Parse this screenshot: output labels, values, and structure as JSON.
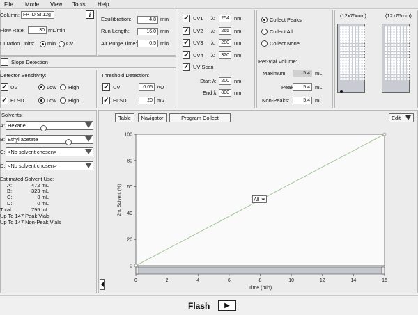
{
  "menu": [
    "File",
    "Mode",
    "View",
    "Tools",
    "Help"
  ],
  "column": {
    "label": "Column:",
    "value": "FP ID SI 12g",
    "info_icon": "i"
  },
  "flow_rate": {
    "label": "Flow Rate:",
    "value": "30",
    "unit": "mL/min"
  },
  "duration_units": {
    "label": "Duration Units:",
    "options": [
      "min",
      "CV"
    ],
    "selected": "min"
  },
  "equilibration": {
    "label": "Equilibration:",
    "value": "4.8",
    "unit": "min"
  },
  "run_length": {
    "label": "Run Length:",
    "value": "16.0",
    "unit": "min"
  },
  "air_purge": {
    "label": "Air Purge Time:",
    "value": "0.5",
    "unit": "min"
  },
  "slope_detection": {
    "label": "Slope Detection",
    "checked": false
  },
  "detector": {
    "title": "Detector Sensitivity:",
    "rows": [
      {
        "name": "UV",
        "checked": true,
        "options": [
          "Low",
          "High"
        ],
        "selected": "Low"
      },
      {
        "name": "ELSD",
        "checked": true,
        "options": [
          "Low",
          "High"
        ],
        "selected": "Low"
      }
    ]
  },
  "threshold": {
    "title": "Threshold Detection:",
    "rows": [
      {
        "name": "UV",
        "checked": true,
        "value": "0.05",
        "unit": "AU"
      },
      {
        "name": "ELSD",
        "checked": true,
        "value": "20",
        "unit": "mV"
      }
    ]
  },
  "uv_channels": [
    {
      "name": "UV1",
      "lambda": "λ:",
      "value": "254",
      "unit": "nm"
    },
    {
      "name": "UV2",
      "lambda": "λ:",
      "value": "265",
      "unit": "nm"
    },
    {
      "name": "UV3",
      "lambda": "λ:",
      "value": "280",
      "unit": "nm"
    },
    {
      "name": "UV4",
      "lambda": "λ:",
      "value": "320",
      "unit": "nm"
    }
  ],
  "uv_scan": {
    "label": "UV Scan",
    "start_label": "Start λ:",
    "start": "200",
    "end_label": "End λ:",
    "end": "800",
    "unit": "nm"
  },
  "collect": {
    "options": [
      "Collect Peaks",
      "Collect All",
      "Collect None"
    ],
    "selected": "Collect Peaks"
  },
  "per_vial": {
    "title": "Per-Vial Volume:",
    "rows": [
      {
        "label": "Maximum:",
        "value": "5.4",
        "unit": "mL"
      },
      {
        "label": "Peak:",
        "value": "5.4",
        "unit": "mL"
      },
      {
        "label": "Non-Peaks:",
        "value": "5.4",
        "unit": "mL"
      }
    ]
  },
  "racks": [
    {
      "label": "(12x75mm)"
    },
    {
      "label": "(12x75mm)"
    }
  ],
  "solvents": {
    "title": "Solvents:",
    "rows": [
      {
        "letter": "A:",
        "value": "Hexane"
      },
      {
        "letter": "B:",
        "value": "Ethyl acetate"
      },
      {
        "letter": "C:",
        "value": "<No solvent chosen>"
      },
      {
        "letter": "D:",
        "value": "<No solvent chosen>"
      }
    ]
  },
  "usage": {
    "title": "Estimated Solvent Use:",
    "rows": [
      {
        "letter": "A:",
        "value": "472 mL"
      },
      {
        "letter": "B:",
        "value": "323 mL"
      },
      {
        "letter": "C:",
        "value": "0 mL"
      },
      {
        "letter": "D:",
        "value": "0 mL"
      },
      {
        "letter": "Total:",
        "value": "795 mL"
      }
    ],
    "peak_vials": "Up To 147 Peak Vials",
    "nonpeak_vials": "Up To 147 Non-Peak Vials"
  },
  "chart_tabs": [
    "Table",
    "Navigator",
    "Program Collect"
  ],
  "edit_button": "Edit",
  "chart_data": {
    "type": "line",
    "series": [
      {
        "x": [
          0,
          16
        ],
        "y": [
          0,
          100
        ]
      }
    ],
    "xlabel": "Time (min)",
    "ylabel": "2nd Solvent (%)",
    "xlim": [
      0,
      16
    ],
    "ylim": [
      0,
      100
    ],
    "xticks": [
      "0",
      "2",
      "4",
      "6",
      "8",
      "10",
      "12",
      "14",
      "16"
    ],
    "yticks": [
      "0",
      "20",
      "40",
      "60",
      "80",
      "100"
    ],
    "selector": "All",
    "grid": false
  },
  "footer": {
    "title": "Flash",
    "play_icon": "▶"
  },
  "colors": {
    "line": "#a6c49a",
    "accent": "#1a1a1a"
  }
}
